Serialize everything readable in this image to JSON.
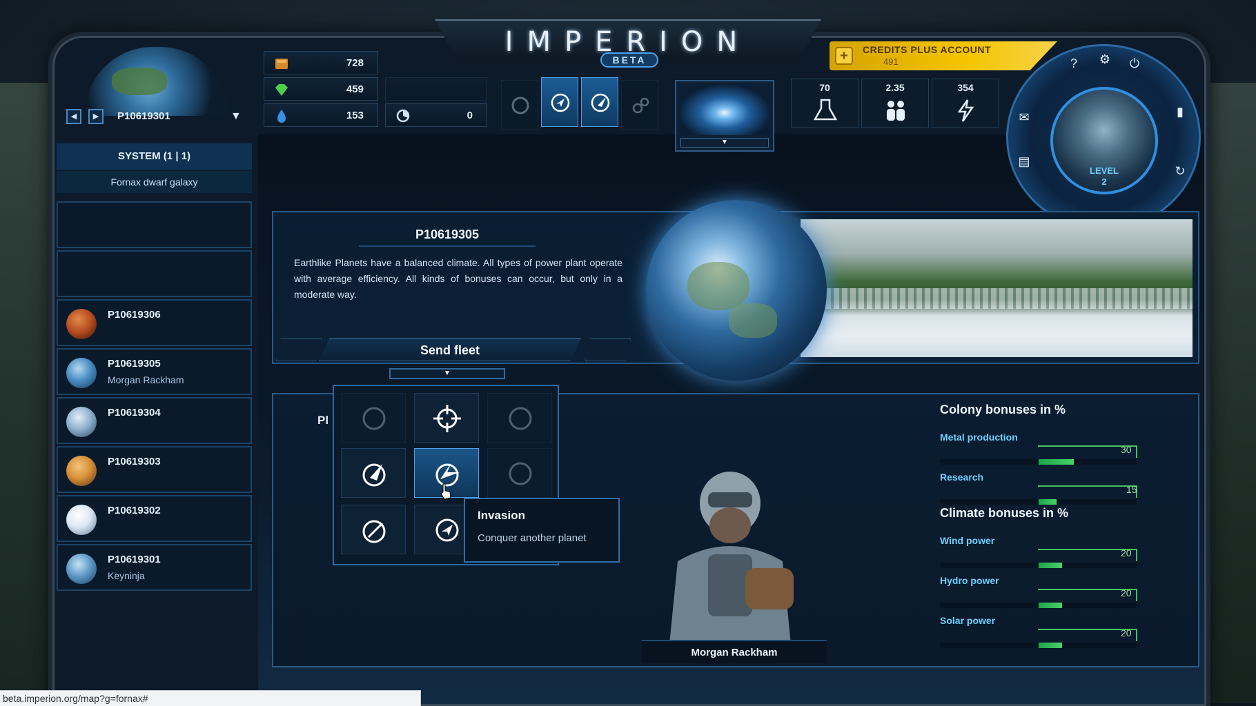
{
  "app": {
    "logo": "IMPERION",
    "badge": "BETA"
  },
  "credits": {
    "title": "CREDITS PLUS ACCOUNT",
    "value": "491"
  },
  "planet_selector": {
    "current": "P10619301"
  },
  "resources": [
    {
      "name": "metal",
      "value": "728",
      "icon": "metal-bar-icon",
      "color": "#d38a2a"
    },
    {
      "name": "crystal",
      "value": "459",
      "icon": "green-gem-icon",
      "color": "#4bd24a"
    },
    {
      "name": "deuterium",
      "value": "153",
      "icon": "water-drop-icon",
      "color": "#3a8fe0"
    },
    {
      "name": "energy-time",
      "value": "0",
      "icon": "clock-icon",
      "color": "#cfe3f5"
    }
  ],
  "stats": [
    {
      "value": "70",
      "icon": "flask-research-icon"
    },
    {
      "value": "2.35",
      "icon": "population-icon"
    },
    {
      "value": "354",
      "icon": "lightning-energy-icon"
    }
  ],
  "avatar": {
    "level_label": "LEVEL",
    "level": "2"
  },
  "sidebar": {
    "system": "SYSTEM (1 | 1)",
    "galaxy": "Fornax dwarf galaxy",
    "planets": [
      {
        "name": "",
        "owner": ""
      },
      {
        "name": "",
        "owner": ""
      },
      {
        "name": "P10619306",
        "owner": "",
        "color": "#b24a1e"
      },
      {
        "name": "P10619305",
        "owner": "Morgan Rackham",
        "color": "#4b8fc4"
      },
      {
        "name": "P10619304",
        "owner": "",
        "color": "#8fb2cf"
      },
      {
        "name": "P10619303",
        "owner": "",
        "color": "#d8903a"
      },
      {
        "name": "P10619302",
        "owner": "",
        "color": "#dbe8f3"
      },
      {
        "name": "P10619301",
        "owner": "Keyninja",
        "color": "#5e9bc8"
      }
    ]
  },
  "planet_info": {
    "name": "P10619305",
    "description": "Earthlike Planets have a balanced climate. All types of power plant operate with average efficiency. All kinds of bonuses can occur, but only in a moderate way.",
    "send_fleet": "Send fleet"
  },
  "lower": {
    "partial_label": "Pl"
  },
  "tooltip": {
    "title": "Invasion",
    "subtitle": "Conquer another planet"
  },
  "commander": {
    "name": "Morgan Rackham"
  },
  "bonuses": {
    "colony_title": "Colony bonuses in %",
    "climate_title": "Climate bonuses in %",
    "colony": [
      {
        "label": "Metal production",
        "value": "30",
        "fraction": 0.3
      },
      {
        "label": "Research",
        "value": "15",
        "fraction": 0.15
      }
    ],
    "climate": [
      {
        "label": "Wind power",
        "value": "20",
        "fraction": 0.2
      },
      {
        "label": "Hydro power",
        "value": "20",
        "fraction": 0.2
      },
      {
        "label": "Solar power",
        "value": "20",
        "fraction": 0.2
      }
    ]
  },
  "statusbar": {
    "url": "beta.imperion.org/map?g=fornax#"
  }
}
